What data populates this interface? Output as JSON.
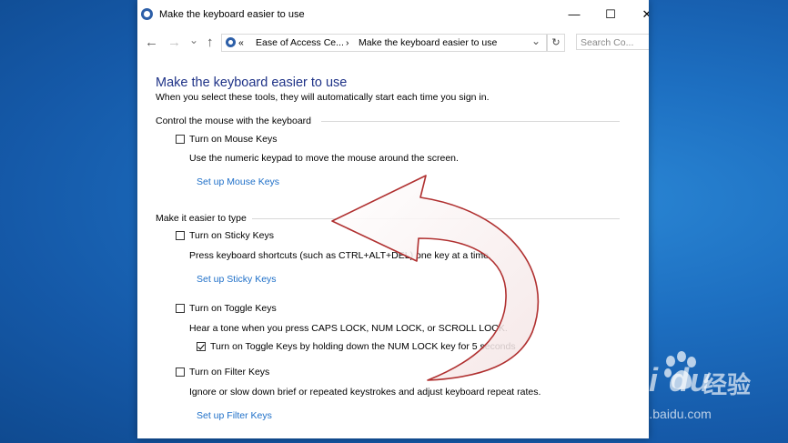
{
  "window": {
    "title": "Make the keyboard easier to use",
    "minimize": "—",
    "maximize": "☐",
    "close": "✕"
  },
  "nav": {
    "back": "←",
    "forward": "→",
    "recent": "⌄",
    "up": "↑"
  },
  "address": {
    "prefix": "«",
    "crumb1": "Ease of Access Ce...",
    "separator": "›",
    "crumb2": "Make the keyboard easier to use",
    "dropdown": "⌄",
    "refresh": "↻"
  },
  "search": {
    "placeholder": "Search Co..."
  },
  "page": {
    "heading": "Make the keyboard easier to use",
    "subtitle": "When you select these tools, they will automatically start each time you sign in."
  },
  "sections": {
    "mouse": {
      "title": "Control the mouse with the keyboard",
      "mouse_keys_label": "Turn on Mouse Keys",
      "mouse_keys_checked": false,
      "mouse_keys_desc": "Use the numeric keypad to move the mouse around the screen.",
      "mouse_keys_link": "Set up Mouse Keys"
    },
    "typing": {
      "title": "Make it easier to type",
      "sticky_label": "Turn on Sticky Keys",
      "sticky_checked": false,
      "sticky_desc": "Press keyboard shortcuts (such as CTRL+ALT+DEL) one key at a time.",
      "sticky_link": "Set up Sticky Keys",
      "toggle_label": "Turn on Toggle Keys",
      "toggle_checked": false,
      "toggle_desc": "Hear a tone when you press CAPS LOCK, NUM LOCK, or SCROLL LOCK.",
      "toggle_hold_label": "Turn on Toggle Keys by holding down the NUM LOCK key for 5 seconds",
      "toggle_hold_checked": true,
      "filter_label": "Turn on Filter Keys",
      "filter_checked": false,
      "filter_desc": "Ignore or slow down brief or repeated keystrokes and adjust keyboard repeat rates.",
      "filter_link": "Set up Filter Keys"
    }
  },
  "watermark": {
    "logo": "Bai  du",
    "brand_cn": "经验",
    "url": "jingyan.baidu.com"
  },
  "colors": {
    "heading": "#1e3287",
    "link": "#1e6fc8",
    "desktop": "#1d6fc1",
    "arrow": "#b03030"
  }
}
